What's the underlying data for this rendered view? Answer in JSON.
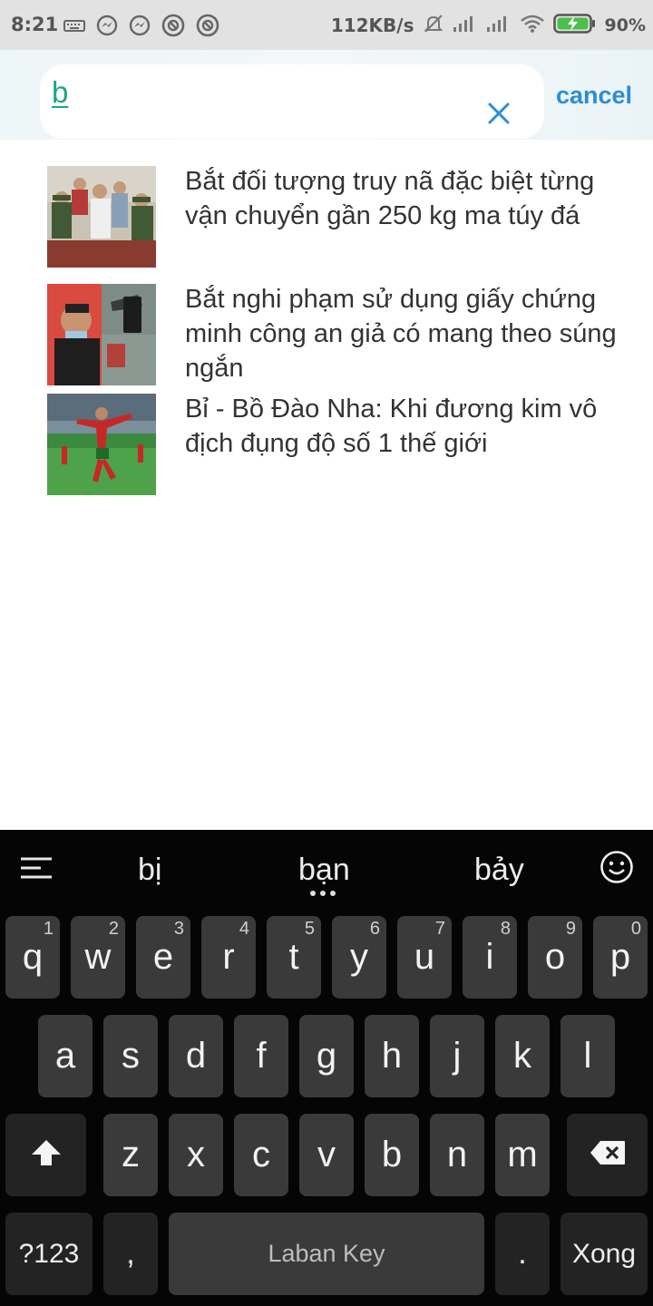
{
  "status_bar": {
    "time": "8:21",
    "network_speed": "112KB/s",
    "battery_percent": "90%",
    "icons": [
      "keyboard-icon",
      "messenger-icon",
      "messenger-icon",
      "app-icon",
      "app-icon",
      "mute-bell-icon",
      "signal-icon",
      "signal-icon",
      "wifi-icon",
      "battery-charging-icon"
    ]
  },
  "search": {
    "query": "b",
    "cancel_label": "cancel"
  },
  "results": [
    {
      "title": "Bắt đối tượng truy nã đặc biệt từng vận chuyển gần 250 kg ma túy đá"
    },
    {
      "title": "Bắt nghi phạm sử dụng giấy chứng minh công an giả có mang theo súng ngắn"
    },
    {
      "title": "Bỉ - Bồ Đào Nha: Khi đương kim vô địch đụng độ số 1 thế giới"
    }
  ],
  "keyboard": {
    "suggestions": [
      "bị",
      "bạn",
      "bảy"
    ],
    "row1": [
      {
        "ch": "q",
        "num": "1"
      },
      {
        "ch": "w",
        "num": "2"
      },
      {
        "ch": "e",
        "num": "3"
      },
      {
        "ch": "r",
        "num": "4"
      },
      {
        "ch": "t",
        "num": "5"
      },
      {
        "ch": "y",
        "num": "6"
      },
      {
        "ch": "u",
        "num": "7"
      },
      {
        "ch": "i",
        "num": "8"
      },
      {
        "ch": "o",
        "num": "9"
      },
      {
        "ch": "p",
        "num": "0"
      }
    ],
    "row2": [
      "a",
      "s",
      "d",
      "f",
      "g",
      "h",
      "j",
      "k",
      "l"
    ],
    "row3": [
      "z",
      "x",
      "c",
      "v",
      "b",
      "n",
      "m"
    ],
    "symbols_label": "?123",
    "comma_label": ",",
    "space_label": "Laban Key",
    "period_label": ".",
    "done_label": "Xong"
  },
  "colors": {
    "query_text": "#17a689",
    "cancel": "#2a8ed8",
    "keyboard_bg": "#050505",
    "key_bg": "#3a3a3a"
  }
}
